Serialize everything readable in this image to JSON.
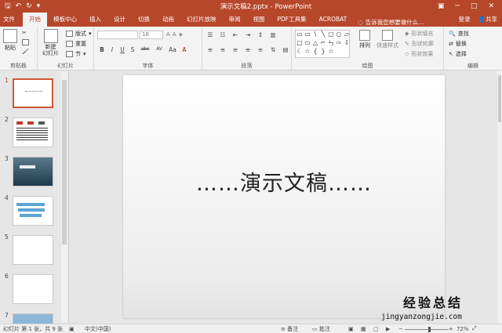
{
  "window": {
    "title": "演示文稿2.pptx - PowerPoint",
    "quick_access": [
      "save-icon",
      "undo-icon",
      "redo-icon",
      "customize-icon"
    ],
    "controls": [
      "restore-icon",
      "minimize-icon",
      "maximize-icon",
      "close-icon"
    ]
  },
  "tabs": [
    "文件",
    "开始",
    "模板中心",
    "插入",
    "设计",
    "切换",
    "动画",
    "幻灯片放映",
    "审阅",
    "视图",
    "PDF工具集",
    "ACROBAT"
  ],
  "active_tab": "开始",
  "tell_me": "告诉我您想要做什么...",
  "account": {
    "login": "登录",
    "share": "共享"
  },
  "ribbon": {
    "clipboard": {
      "label": "剪贴板",
      "paste": "粘贴"
    },
    "slides": {
      "label": "幻灯片",
      "new_slide": "新建\n幻灯片",
      "layout": "版式",
      "reset": "重置",
      "section": "节"
    },
    "font": {
      "label": "字体",
      "font_name": "",
      "font_size": "18",
      "buttons": [
        "B",
        "I",
        "U",
        "S",
        "abc",
        "AV",
        "Aa",
        "A"
      ]
    },
    "paragraph": {
      "label": "段落"
    },
    "drawing": {
      "label": "绘图",
      "shapes": [
        "▭",
        "▭",
        "\\",
        "╲",
        "▢",
        "○",
        "▱",
        "□",
        "▭",
        "△",
        "⌐",
        "ㄣ",
        "⇨",
        "⇩",
        "☾",
        "☆",
        "{",
        "}",
        "☆"
      ],
      "arrange": "排列",
      "quick_styles": "快速样式",
      "fill": "形状填充",
      "outline": "形状轮廓",
      "effects": "形状效果"
    },
    "editing": {
      "label": "编辑",
      "find": "查找",
      "replace": "替换",
      "select": "选择"
    }
  },
  "thumbnails": [
    {
      "num": "1",
      "selected": true
    },
    {
      "num": "2",
      "selected": false
    },
    {
      "num": "3",
      "selected": false
    },
    {
      "num": "4",
      "selected": false
    },
    {
      "num": "5",
      "selected": false
    },
    {
      "num": "6",
      "selected": false
    },
    {
      "num": "7",
      "selected": false
    }
  ],
  "slide": {
    "title": "……演示文稿……"
  },
  "watermark": {
    "text": "经验总结",
    "url": "jingyanzongjie.com"
  },
  "status": {
    "slide_info": "幻灯片 第 1 张，共 9 张",
    "language": "中文(中国)",
    "notes": "备注",
    "comments": "批注",
    "zoom": "72%"
  }
}
